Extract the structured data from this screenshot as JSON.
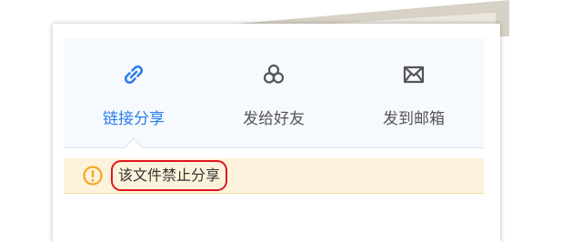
{
  "share_tabs": [
    {
      "label": "链接分享",
      "icon": "link-icon",
      "active": true
    },
    {
      "label": "发给好友",
      "icon": "friends-icon",
      "active": false
    },
    {
      "label": "发到邮箱",
      "icon": "mail-icon",
      "active": false
    }
  ],
  "notice": {
    "icon": "warning-icon",
    "text": "该文件禁止分享"
  },
  "colors": {
    "accent": "#2b7ce9",
    "warning_bg": "#fdf3dc",
    "warning_icon": "#f5a623",
    "highlight_ring": "#e2161b"
  }
}
